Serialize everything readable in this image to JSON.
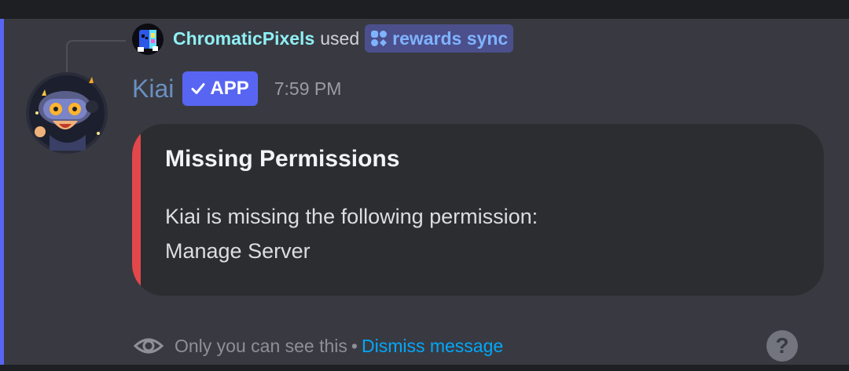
{
  "colors": {
    "accent_bar": "#5865f2",
    "referenced_username": "#8ff0f5",
    "bot_name": "#6a8fc2",
    "app_badge": "#5865f2",
    "embed_stripe": "#e2474b",
    "link": "#00a8fc",
    "message_background": "#393a41"
  },
  "reference": {
    "username": "ChromaticPixels",
    "action_text": "used",
    "command_icon": "app-command-icon",
    "command_name": "rewards sync"
  },
  "message": {
    "author": "Kiai",
    "badge_label": "APP",
    "badge_icon": "check-icon",
    "timestamp": "7:59 PM"
  },
  "embed": {
    "title": "Missing Permissions",
    "description_lines": [
      "Kiai is missing the following permission:",
      "Manage Server"
    ]
  },
  "footer": {
    "eye_icon": "eye-icon",
    "note": "Only you can see this",
    "separator": "•",
    "dismiss_label": "Dismiss message",
    "help_icon": "help-icon",
    "help_glyph": "?"
  }
}
